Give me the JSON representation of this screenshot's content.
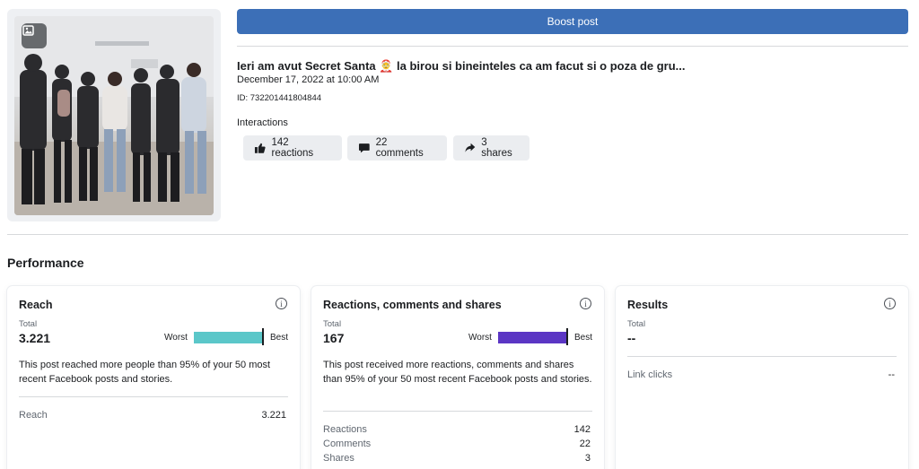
{
  "boost": {
    "label": "Boost post"
  },
  "post": {
    "title": "Ieri am avut Secret Santa 🤶 la birou si bineinteles ca am facut si o poza de gru...",
    "date": "December 17, 2022 at 10:00 AM",
    "id": "ID: 732201441804844",
    "interactions_label": "Interactions",
    "chips": [
      {
        "label": "142 reactions",
        "icon": "thumbs-up-icon"
      },
      {
        "label": "22 comments",
        "icon": "comment-icon"
      },
      {
        "label": "3 shares",
        "icon": "share-icon"
      }
    ]
  },
  "performance": {
    "title": "Performance",
    "cards": [
      {
        "title": "Reach",
        "total_label": "Total",
        "total_value": "3.221",
        "worst_label": "Worst",
        "best_label": "Best",
        "bar_color": "#5bc7c9",
        "description": "This post reached more people than 95% of your 50 most recent Facebook posts and stories.",
        "rows": [
          {
            "label": "Reach",
            "value": "3.221"
          }
        ]
      },
      {
        "title": "Reactions, comments and shares",
        "total_label": "Total",
        "total_value": "167",
        "worst_label": "Worst",
        "best_label": "Best",
        "bar_color": "#5b36c4",
        "description": "This post received more reactions, comments and shares than 95% of your 50 most recent Facebook posts and stories.",
        "rows": [
          {
            "label": "Reactions",
            "value": "142"
          },
          {
            "label": "Comments",
            "value": "22"
          },
          {
            "label": "Shares",
            "value": "3"
          }
        ]
      },
      {
        "title": "Results",
        "total_label": "Total",
        "total_value": "--",
        "rows": [
          {
            "label": "Link clicks",
            "value": "--"
          }
        ]
      }
    ]
  },
  "colors": {
    "accent": "#3c6fb7"
  }
}
